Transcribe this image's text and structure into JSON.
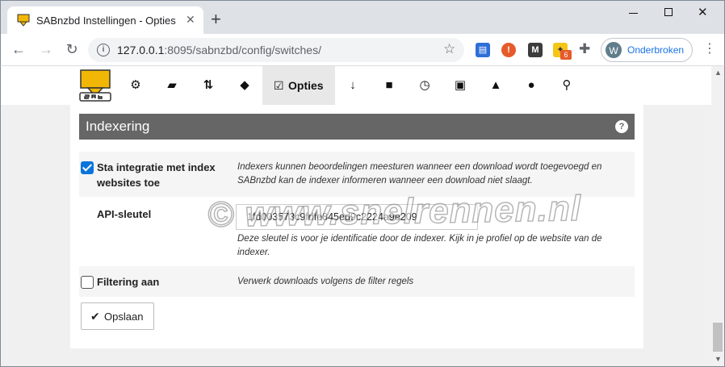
{
  "browser": {
    "tab_title": "SABnzbd Instellingen - Opties",
    "tab_close": "✕",
    "new_tab": "+",
    "url_host": "127.0.0.1",
    "url_rest": ":8095/sabnzbd/config/switches/",
    "profile_initial": "W",
    "profile_label": "Onderbroken",
    "ext_badge": "6"
  },
  "nav": {
    "active_label": "Opties"
  },
  "section": {
    "title": "Indexering"
  },
  "settings": [
    {
      "label": "Sta integratie met index websites toe",
      "checked": true,
      "description": "Indexers kunnen beoordelingen meesturen wanneer een download wordt toegevoegd en SABnzbd kan de indexer informeren wanneer een download niet slaagt."
    },
    {
      "label": "API-sleutel",
      "value": "1fd003573c9fdfe845ed9c2224a9e209",
      "description": "Deze sleutel is voor je identificatie door de indexer. Kijk in je profiel op de website van de indexer."
    },
    {
      "label": "Filtering aan",
      "checked": false,
      "description": "Verwerk downloads volgens de filter regels"
    }
  ],
  "save_button": {
    "label": "Opslaan"
  },
  "watermark": "© www.snelrennen.nl",
  "colors": {
    "accent": "#0b74da",
    "section_header": "#666666",
    "logo_yellow": "#f2b705"
  }
}
